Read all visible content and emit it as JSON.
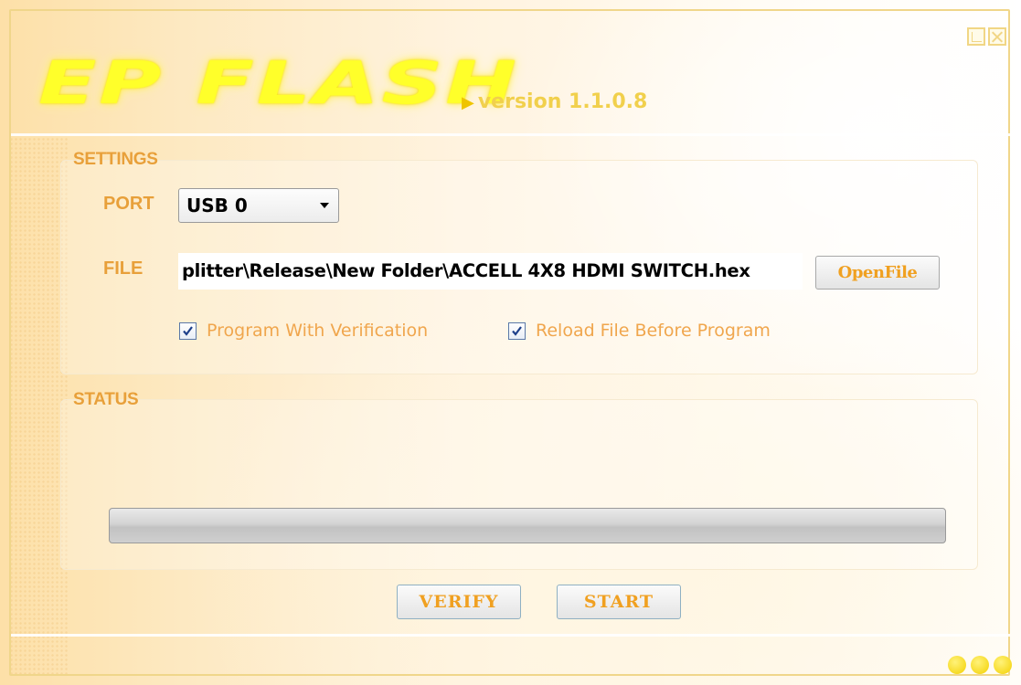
{
  "app": {
    "title": "EP FLASH",
    "version": "version 1.1.0.8",
    "colors": {
      "accent": "#e8a03a",
      "logo": "#ffff2a",
      "frame": "#f0d68a"
    }
  },
  "window_controls": [
    {
      "icon": "maximize-icon"
    },
    {
      "icon": "close-icon"
    }
  ],
  "settings": {
    "title": "SETTINGS",
    "port_label": "PORT",
    "port_value": "USB 0",
    "file_label": "FILE",
    "file_value": "plitter\\Release\\New Folder\\ACCELL 4X8 HDMI SWITCH.hex",
    "open_file_label": "OpenFile",
    "verify_checkbox": {
      "label": "Program With Verification",
      "checked": true
    },
    "reload_checkbox": {
      "label": "Reload File Before Program",
      "checked": true
    }
  },
  "status": {
    "title": "STATUS",
    "progress": 0
  },
  "buttons": {
    "verify": "VERIFY",
    "start": "START"
  }
}
